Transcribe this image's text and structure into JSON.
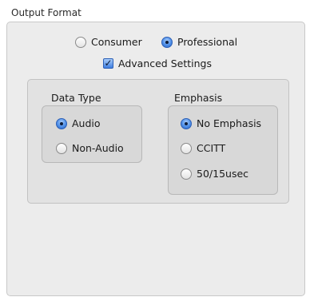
{
  "output_format": {
    "title": "Output Format",
    "mode_options": [
      {
        "label": "Consumer",
        "selected": false
      },
      {
        "label": "Professional",
        "selected": true
      }
    ],
    "advanced_settings": {
      "label": "Advanced Settings",
      "checked": true
    }
  },
  "data_type": {
    "title": "Data Type",
    "options": [
      {
        "label": "Audio",
        "selected": true
      },
      {
        "label": "Non-Audio",
        "selected": false
      }
    ]
  },
  "emphasis": {
    "title": "Emphasis",
    "options": [
      {
        "label": "No Emphasis",
        "selected": true
      },
      {
        "label": "CCITT",
        "selected": false
      },
      {
        "label": "50/15usec",
        "selected": false
      }
    ]
  }
}
